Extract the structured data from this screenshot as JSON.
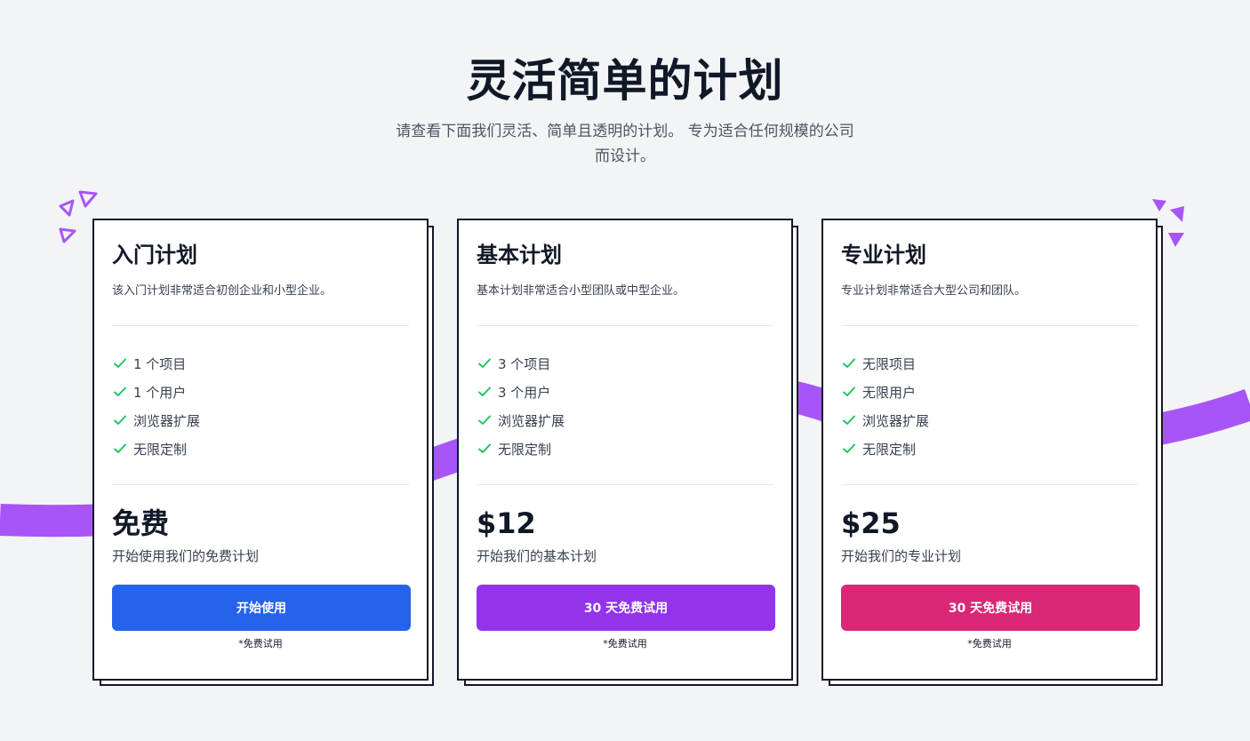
{
  "page": {
    "title": "灵活简单的计划",
    "subtitle": "请查看下面我们灵活、简单且透明的计划。 专为适合任何规模的公司而设计。"
  },
  "colors": {
    "background": "#f3f4f6",
    "ribbon": "#a855f7",
    "check": "#22c55e",
    "decoration": "#a855f7"
  },
  "plans": [
    {
      "title": "入门计划",
      "description": "该入门计划非常适合初创企业和小型企业。",
      "features": [
        "1 个项目",
        "1 个用户",
        "浏览器扩展",
        "无限定制"
      ],
      "price": "免费",
      "price_note": "开始使用我们的免费计划",
      "cta_label": "开始使用",
      "cta_color": "#2563eb",
      "footnote": "*免费试用"
    },
    {
      "title": "基本计划",
      "description": "基本计划非常适合小型团队或中型企业。",
      "features": [
        "3 个项目",
        "3 个用户",
        "浏览器扩展",
        "无限定制"
      ],
      "price": "$12",
      "price_note": "开始我们的基本计划",
      "cta_label": "30 天免费试用",
      "cta_color": "#9333ea",
      "footnote": "*免费试用"
    },
    {
      "title": "专业计划",
      "description": "专业计划非常适合大型公司和团队。",
      "features": [
        "无限项目",
        "无限用户",
        "浏览器扩展",
        "无限定制"
      ],
      "price": "$25",
      "price_note": "开始我们的专业计划",
      "cta_label": "30 天免费试用",
      "cta_color": "#db2777",
      "footnote": "*免费试用"
    }
  ]
}
